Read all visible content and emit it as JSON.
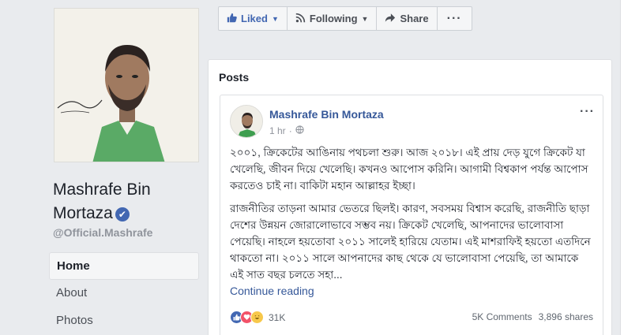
{
  "profile": {
    "name_line1": "Mashrafe Bin",
    "name_line2": "Mortaza",
    "verified_mark": "✔",
    "handle": "@Official.Mashrafe"
  },
  "nav": {
    "items": [
      {
        "label": "Home",
        "active": true
      },
      {
        "label": "About",
        "active": false
      },
      {
        "label": "Photos",
        "active": false
      }
    ]
  },
  "actions": {
    "liked_label": "Liked",
    "following_label": "Following",
    "share_label": "Share",
    "more_label": "···"
  },
  "posts": {
    "section_title": "Posts",
    "post": {
      "author": "Mashrafe Bin Mortaza",
      "time": "1 hr",
      "options": "···",
      "paragraph1": "২০০১, ক্রিকেটের আঙিনায় পথচলা শুরু। আজ ২০১৮। এই প্রায় দেড় যুগে ক্রিকেট যা খেলেছি, জীবন দিয়ে খেলেছি। কখনও আপোস করিনি। আগামী বিশ্বকাপ পর্যন্ত আপোস করতেও চাই না। বাকিটা মহান আল্লাহর ইচ্ছা।",
      "paragraph2": "রাজনীতির তাড়না আমার ভেতরে ছিলই। কারণ, সবসময় বিশ্বাস করেছি, রাজনীতি ছাড়া দেশের উন্নয়ন জোরালোভাবে সম্ভব নয়। ক্রিকেট খেলেছি, আপনাদের ভালোবাসা পেয়েছি। নাহলে হয়তোবা ২০১১ সালেই হারিয়ে যেতাম। এই মাশরাফিই হয়তো এতদিনে থাকতো না। ২০১১ সালে আপনাদের কাছ থেকে যে ভালোবাসা পেয়েছি, তা আমাকে এই সাত বছর চলতে সহা...",
      "continue_label": "Continue reading",
      "reaction_count": "31K",
      "comments": "5K Comments",
      "shares": "3,896 shares"
    }
  },
  "colors": {
    "link": "#365899",
    "brand": "#4267b2",
    "background": "#e9ebee"
  }
}
